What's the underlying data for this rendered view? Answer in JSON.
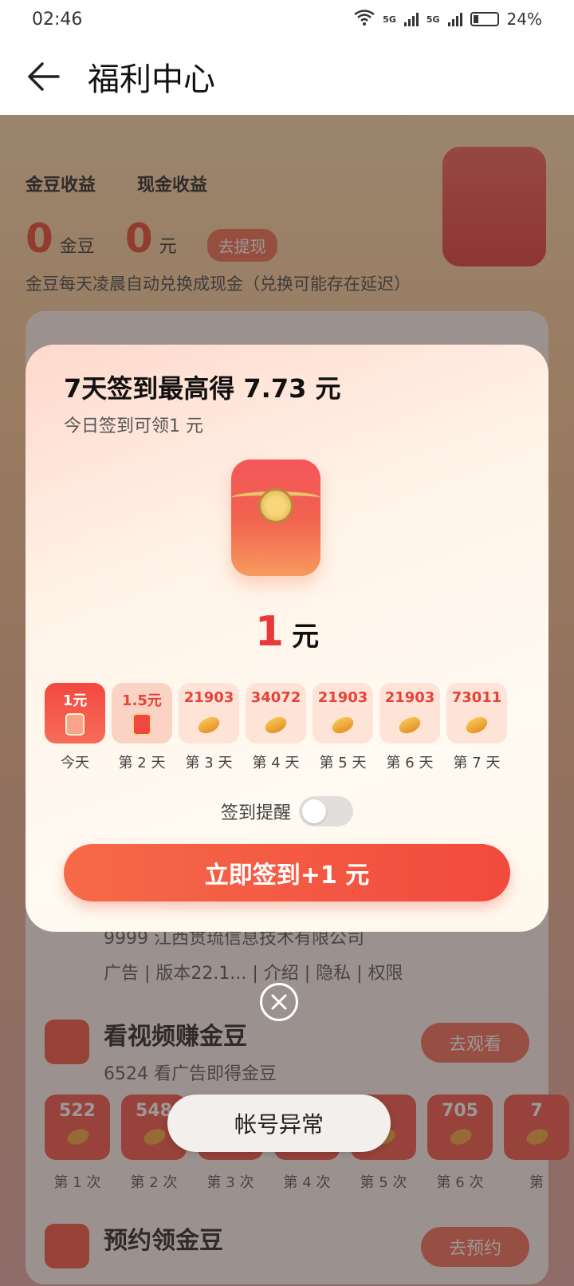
{
  "status": {
    "time": "02:46",
    "net1": "5G",
    "net2": "5G",
    "battery": "24%"
  },
  "header": {
    "title": "福利中心"
  },
  "earnings": {
    "bean_label": "金豆收益",
    "cash_label": "现金收益",
    "bean_value": "0",
    "bean_unit": "金豆",
    "cash_value": "0",
    "cash_unit": "元",
    "withdraw_label": "去提现",
    "note": "金豆每天凌晨自动兑换成现金（兑换可能存在延迟）"
  },
  "background": {
    "app_sub": "9999 江西贯琉信息技术有限公司",
    "app_meta": "广告 | 版本22.1... | 介绍 | 隐私 | 权限",
    "video_title": "看视频赚金豆",
    "video_sub": "6524 看广告即得金豆",
    "video_btn": "去观看",
    "video_rewards": [
      "522",
      "548",
      "",
      "",
      "",
      "705",
      "7"
    ],
    "video_labels": [
      "第 1 次",
      "第 2 次",
      "第 3 次",
      "第 4 次",
      "第 5 次",
      "第 6 次",
      "第"
    ],
    "reserve_title": "预约领金豆",
    "reserve_btn": "去预约"
  },
  "modal": {
    "title": "7天签到最高得 7.73 元",
    "subtitle": "今日签到可领1 元",
    "amount": "1",
    "amount_unit": "元",
    "days": [
      {
        "reward": "1元",
        "label": "今天",
        "kind": "packet",
        "state": "today"
      },
      {
        "reward": "1.5元",
        "label": "第 2 天",
        "kind": "packet",
        "state": "second"
      },
      {
        "reward": "21903",
        "label": "第 3 天",
        "kind": "bean",
        "state": ""
      },
      {
        "reward": "34072",
        "label": "第 4 天",
        "kind": "bean",
        "state": ""
      },
      {
        "reward": "21903",
        "label": "第 5 天",
        "kind": "bean",
        "state": ""
      },
      {
        "reward": "21903",
        "label": "第 6 天",
        "kind": "bean",
        "state": ""
      },
      {
        "reward": "73011",
        "label": "第 7 天",
        "kind": "bean",
        "state": ""
      }
    ],
    "reminder_label": "签到提醒",
    "reminder_on": false,
    "signin_button": "立即签到+1 元"
  },
  "toast": {
    "text": "帐号异常"
  },
  "colors": {
    "accent": "#f14a3e",
    "gold": "#f0a53a"
  }
}
